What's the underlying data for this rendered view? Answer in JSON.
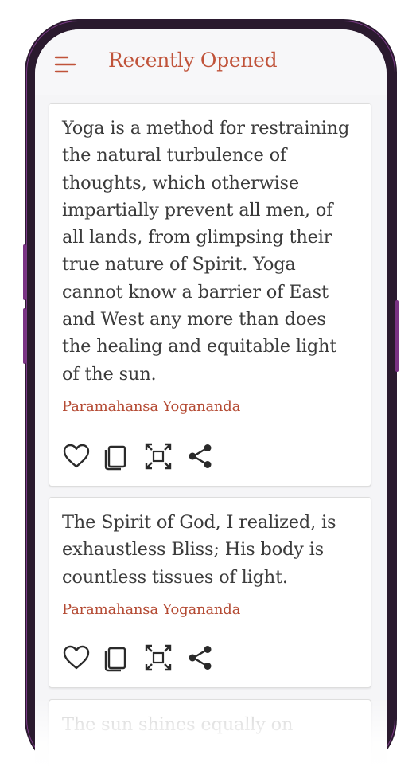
{
  "header": {
    "title": "Recently Opened"
  },
  "cards": [
    {
      "quote": "Yoga is a method for restraining the natural turbulence of thoughts, which otherwise impartially prevent all men, of all lands, from glimpsing their true nature of Spirit. Yoga cannot know a barrier of East and West any more than does the healing and equitable light of the sun.",
      "author": "Paramahansa Yogananda"
    },
    {
      "quote": "The Spirit of God, I realized, is exhaustless Bliss; His body is countless tissues of light.",
      "author": "Paramahansa Yogananda"
    },
    {
      "quote": "The sun shines equally on"
    }
  ],
  "icons": {
    "menu": "menu-icon",
    "like": "heart-icon",
    "copy": "copy-icon",
    "expand": "expand-icon",
    "share": "share-icon"
  },
  "colors": {
    "accent": "#c0533a",
    "author": "#b44a33",
    "text": "#3b3b3b",
    "frame": "#7a3384"
  }
}
